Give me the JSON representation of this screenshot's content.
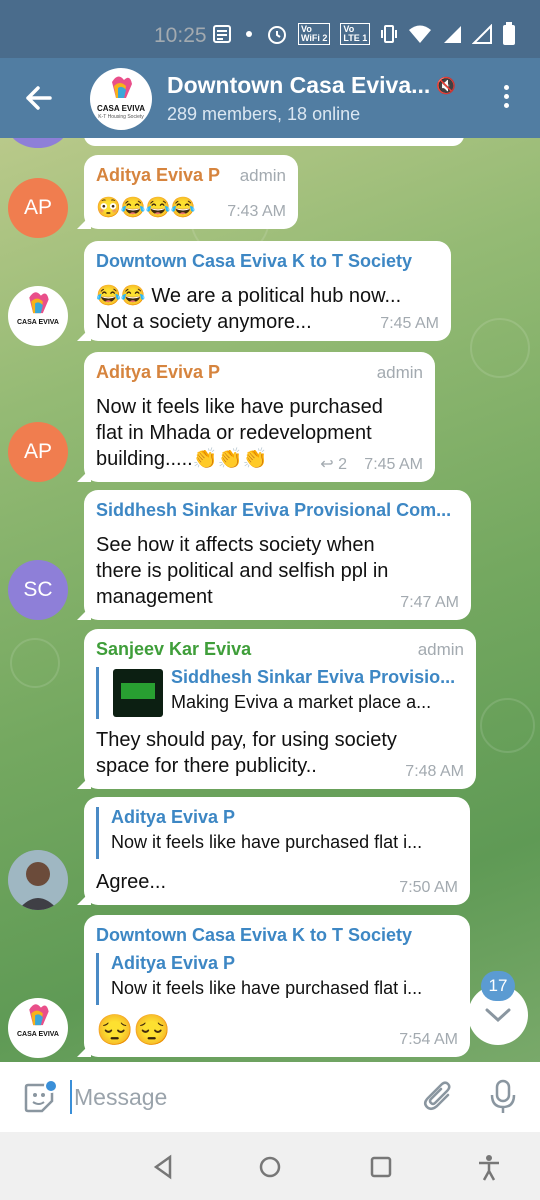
{
  "status_bar": {
    "time": "10:25",
    "icons": [
      "notes-icon",
      "dot-icon",
      "alarm-icon",
      "vowifi-icon",
      "volte-icon",
      "vibrate-icon",
      "wifi-icon",
      "signal-icon",
      "signal-icon",
      "battery-icon"
    ],
    "vowifi_label": "Vo\nWiFi 2",
    "volte_label": "Vo\nLTE 1"
  },
  "header": {
    "title": "Downtown Casa Eviva...",
    "subtitle": "289 members, 18 online",
    "avatar_logo_text": "CASA EVIVA",
    "avatar_logo_sub": "K-T Housing Society",
    "muted_icon": "muted-speaker-icon"
  },
  "messages": [
    {
      "avatar_initials": "AP",
      "sender": "Aditya Eviva P",
      "sender_color": "#d6843e",
      "role": "admin",
      "text_lines": [
        "😳😂😂😂"
      ],
      "time": "7:43 AM"
    },
    {
      "avatar_logo": "CASA EVIVA",
      "sender": "Downtown Casa Eviva K to T Society",
      "sender_color": "#3d87c4",
      "text_lines": [
        "😂😂 We are a political hub now...",
        "Not a society anymore..."
      ],
      "time": "7:45 AM"
    },
    {
      "avatar_initials": "AP",
      "sender": "Aditya Eviva P",
      "sender_color": "#d6843e",
      "role": "admin",
      "text_lines": [
        "Now it feels like have purchased",
        "flat in Mhada or redevelopment",
        "building.....👏👏👏"
      ],
      "replies": "2",
      "time": "7:45 AM"
    },
    {
      "avatar_initials": "SC",
      "sender": "Siddhesh Sinkar Eviva Provisional Com...",
      "sender_color": "#3d87c4",
      "text_lines": [
        "See how it affects society when",
        "there is political and selfish ppl in",
        "management"
      ],
      "time": "7:47 AM"
    },
    {
      "sender": "Sanjeev Kar Eviva",
      "sender_color": "#3f9e3a",
      "role": "admin",
      "reply_to": {
        "name": "Siddhesh Sinkar Eviva Provisio...",
        "text": "Making Eviva a market place a..."
      },
      "text_lines": [
        "They should pay, for using society",
        "space for there publicity.."
      ],
      "time": "7:48 AM"
    },
    {
      "avatar_photo": "user-photo",
      "reply_to": {
        "name": "Aditya Eviva P",
        "text": "Now it feels like have purchased flat i..."
      },
      "text_lines": [
        "Agree..."
      ],
      "time": "7:50 AM"
    },
    {
      "avatar_logo": "CASA EVIVA",
      "sender": "Downtown Casa Eviva K to T Society",
      "sender_color": "#3d87c4",
      "reply_to": {
        "name": "Aditya Eviva P",
        "text": "Now it feels like have purchased flat i..."
      },
      "text_lines": [
        "😔😔"
      ],
      "time": "7:54 AM"
    }
  ],
  "unread_count": "17",
  "composer": {
    "placeholder": "Message"
  },
  "colors": {
    "header": "#517da2",
    "status_bar": "#4a6c8c",
    "accent": "#3a8fd8"
  }
}
